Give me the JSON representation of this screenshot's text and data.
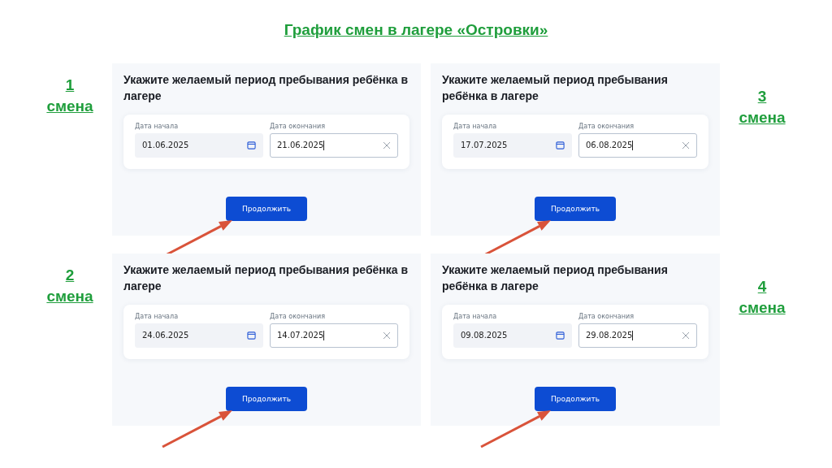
{
  "title": "График смен в лагере «Островки»",
  "shifts": [
    {
      "number": "1",
      "word": "смена",
      "heading": "Укажите желаемый период пребывания ребёнка в лагере",
      "start_label": "Дата начала",
      "start_value": "01.06.2025",
      "end_label": "Дата окончания",
      "end_value": "21.06.2025",
      "button": "Продолжить"
    },
    {
      "number": "3",
      "word": "смена",
      "heading": "Укажите желаемый период пребывания ребёнка в лагере",
      "start_label": "Дата начала",
      "start_value": "17.07.2025",
      "end_label": "Дата окончания",
      "end_value": "06.08.2025",
      "button": "Продолжить"
    },
    {
      "number": "2",
      "word": "смена",
      "heading": "Укажите желаемый период пребывания ребёнка в лагере",
      "start_label": "Дата начала",
      "start_value": "24.06.2025",
      "end_label": "Дата окончания",
      "end_value": "14.07.2025",
      "button": "Продолжить"
    },
    {
      "number": "4",
      "word": "смена",
      "heading": "Укажите желаемый период пребывания ребёнка в лагере",
      "start_label": "Дата начала",
      "start_value": "09.08.2025",
      "end_label": "Дата окончания",
      "end_value": "29.08.2025",
      "button": "Продолжить"
    }
  ]
}
